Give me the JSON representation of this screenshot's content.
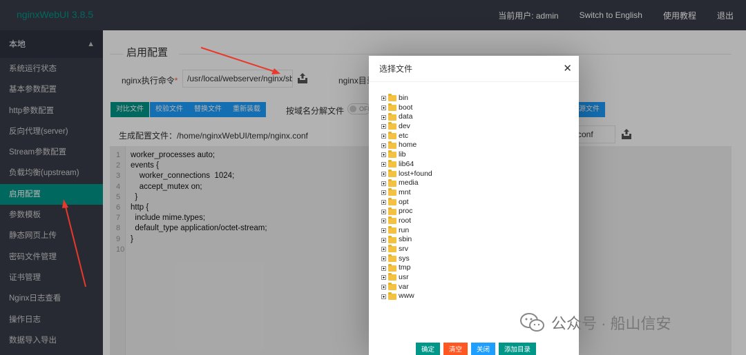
{
  "app": {
    "title": "nginxWebUI 3.8.5",
    "nav": [
      "当前用户: admin",
      "Switch to English",
      "使用教程",
      "退出"
    ]
  },
  "sidebar": {
    "group": "本地",
    "items": [
      "系统运行状态",
      "基本参数配置",
      "http参数配置",
      "反向代理(server)",
      "Stream参数配置",
      "负载均衡(upstream)",
      "启用配置",
      "参数模板",
      "静态网页上传",
      "密码文件管理",
      "证书管理",
      "Nginx日志查看",
      "操作日志",
      "数据导入导出"
    ],
    "active_index": 6
  },
  "main": {
    "title": "启用配置",
    "cmd_label": "nginx执行命令",
    "cmd_value": "/usr/local/webserver/nginx/sbin/",
    "dir_label": "nginx目录",
    "buttons": [
      "对比文件",
      "校验文件",
      "替换文件",
      "重新装载"
    ],
    "split_label": "按域名分解文件",
    "switch_state": "OFF",
    "right_button": "源文件",
    "gen_label": "生成配置文件：",
    "gen_path": "/home/nginxWebUI/temp/nginx.conf",
    "right_field": "conf"
  },
  "editor": {
    "lines": [
      "worker_processes auto;",
      "events {",
      "    worker_connections  1024;",
      "    accept_mutex on;",
      "  }",
      "http {",
      "  include mime.types;",
      "  default_type application/octet-stream;",
      "}",
      ""
    ]
  },
  "modal": {
    "title": "选择文件",
    "folders": [
      "bin",
      "boot",
      "data",
      "dev",
      "etc",
      "home",
      "lib",
      "lib64",
      "lost+found",
      "media",
      "mnt",
      "opt",
      "proc",
      "root",
      "run",
      "sbin",
      "srv",
      "sys",
      "tmp",
      "usr",
      "var",
      "www"
    ],
    "buttons": [
      "确定",
      "清空",
      "关闭",
      "添加目录"
    ]
  },
  "watermark": {
    "text": "公众号 · 船山信安"
  },
  "colors": {
    "accent": "#009688",
    "blue": "#1e9fff",
    "orange": "#ff5722",
    "arrow": "#e8392a"
  }
}
